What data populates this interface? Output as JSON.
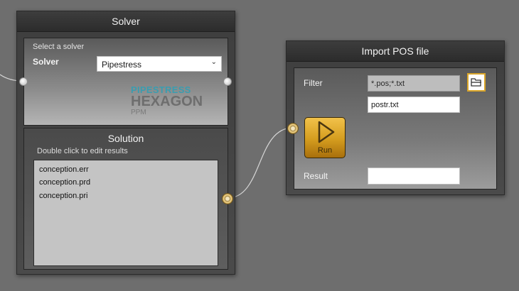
{
  "solver_node": {
    "title": "Solver",
    "select_caption": "Select a solver",
    "solver_label": "Solver",
    "solver_value": "Pipestress",
    "logo": {
      "line1": "PIPESTRESS",
      "line2": "HEXAGON",
      "line3": "PPM"
    },
    "solution": {
      "title": "Solution",
      "hint": "Double click to edit results",
      "files": [
        "conception.err",
        "conception.prd",
        "conception.pri"
      ]
    }
  },
  "import_node": {
    "title": "Import POS file",
    "filter_label": "Filter",
    "filter_value": "*.pos;*.txt",
    "file_value": "postr.txt",
    "run_label": "Run",
    "result_label": "Result",
    "result_value": ""
  },
  "colors": {
    "canvas": "#6e6e6e",
    "accent_gold": "#d9a529",
    "logo_teal": "#3a9db0",
    "logo_gray": "#6e6e6e"
  },
  "icons": [
    "chevron-down-icon",
    "folder-open-icon",
    "play-icon",
    "port-icon"
  ]
}
